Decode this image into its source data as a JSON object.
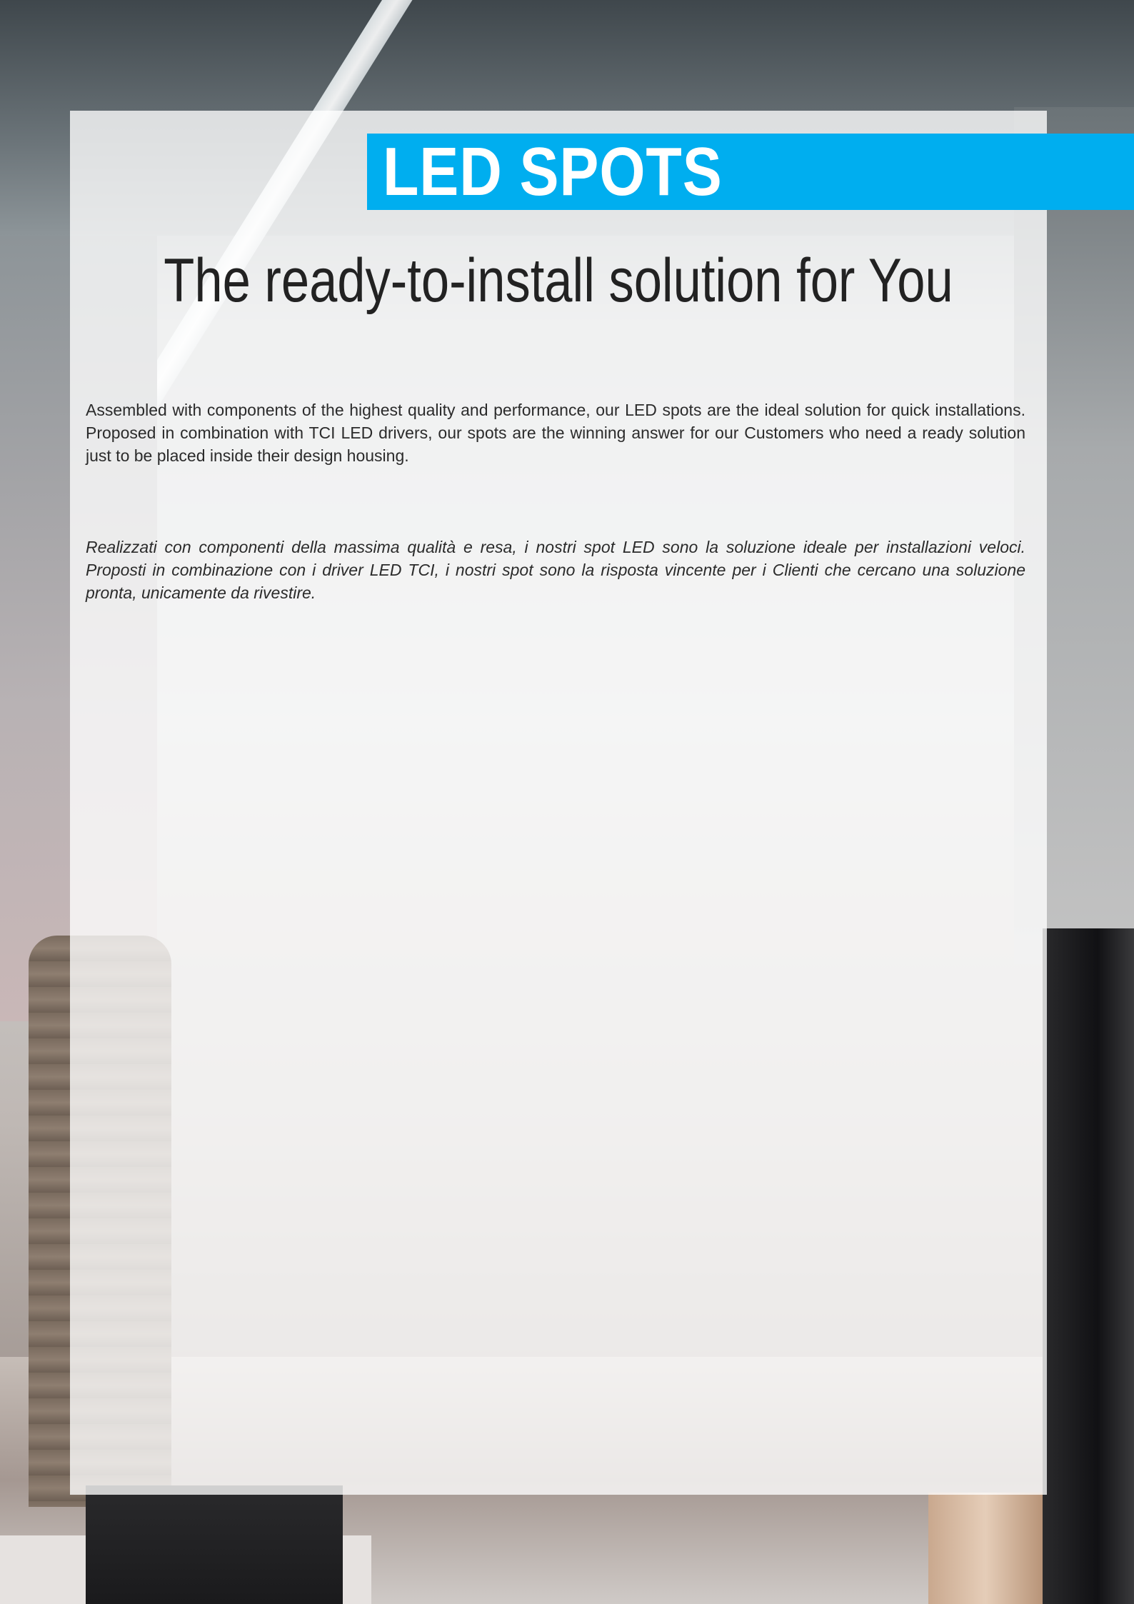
{
  "title": "LED SPOTS",
  "subtitle": "The ready-to-install solution for You",
  "paragraph_en": "Assembled with components of the highest quality and performance, our LED spots are the ideal solution for quick installations. Proposed in combination with TCI LED drivers, our spots are the winning answer for our Customers who need a ready solution just to be placed inside their design housing.",
  "paragraph_it": "Realizzati con componenti della massima qualità e resa, i nostri spot LED sono la soluzione ideale per installazioni veloci. Proposti in combinazione con i driver LED TCI, i nostri spot sono la risposta vincente per i Clienti che cercano una soluzione pronta, unicamente da rivestire.",
  "colors": {
    "accent": "#00aeef",
    "title_text": "#ffffff",
    "body_text": "#2b2b2b"
  }
}
